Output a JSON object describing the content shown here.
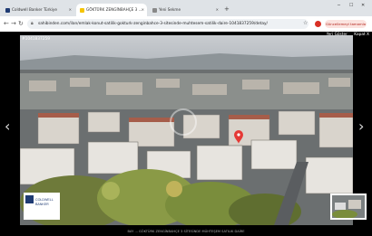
{
  "browser": {
    "tabs": [
      {
        "label": "Coldwell Banker Türkiye",
        "favicon_color": "#1f3b73",
        "active": false
      },
      {
        "label": "GÖKTÜRK ZENGİNBAHÇE 3 ...",
        "favicon_color": "#f5c400",
        "active": true
      },
      {
        "label": "Yeni Sekme",
        "favicon_color": "#888888",
        "active": false
      }
    ],
    "url": "sahibinden.com/ilan/emlak-konut-satilik-gokturk-zenginbahce-3-sitesinde-muhtesem-satilik-daire-1041837259/detay/",
    "update_button_label": "Güncellemeyi tamamla"
  },
  "gallery": {
    "photo_id": "#1041837259",
    "controls": {
      "map_label": "Yeri Göster",
      "close_label": "Kapat X"
    },
    "caption": "BAY ... GÖKTÜRK ZENGİNBAHÇE 3 SİTESİNDE MÜHTEŞEM SATILIK DAİRE",
    "watermark": "COLDWELL BANKER"
  },
  "icons": {
    "prev": "chevron-left-icon",
    "next": "chevron-right-icon",
    "lock": "lock-icon"
  },
  "colors": {
    "accent_red": "#e53935",
    "update_bg": "#fbe3df"
  }
}
